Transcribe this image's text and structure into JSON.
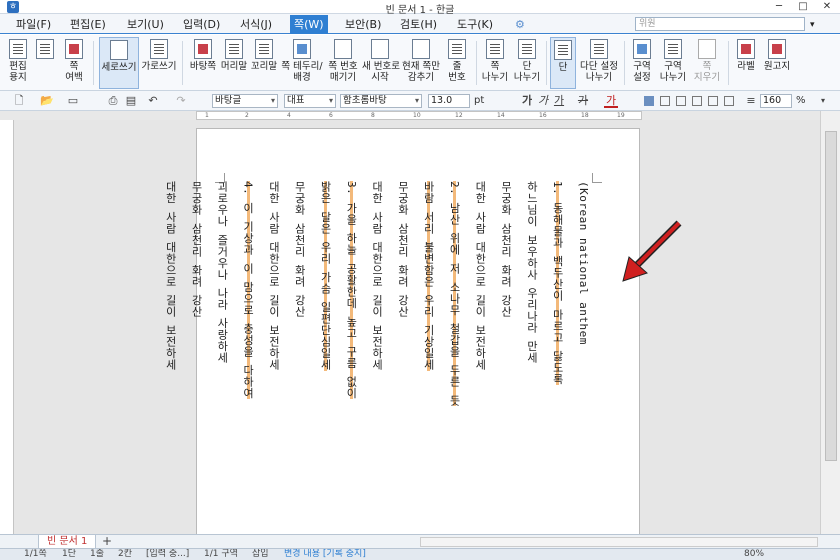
{
  "window": {
    "title": "빈 문서 1 - 한글",
    "minimize": "─",
    "maximize": "□",
    "close": "✕"
  },
  "menu": {
    "items": [
      "파일(F)",
      "편집(E)",
      "보기(U)",
      "입력(D)",
      "서식(J)",
      "쪽(W)",
      "보안(B)",
      "검토(H)",
      "도구(K)"
    ],
    "active": "쪽(W)",
    "search_placeholder": "위원"
  },
  "ribbon": {
    "buttons": [
      {
        "label": "편집\n용지",
        "icon": "page-setup-icon"
      },
      {
        "label": "",
        "icon": "page-portrait-icon"
      },
      {
        "label": "쪽\n여백",
        "icon": "margin-icon"
      },
      {
        "label": "세로쓰기",
        "icon": "vertical-writing-icon",
        "selected": true
      },
      {
        "label": "가로쓰기",
        "icon": "horizontal-writing-icon"
      },
      {
        "label": "바탕쪽",
        "icon": "master-page-icon"
      },
      {
        "label": "머리말",
        "icon": "header-icon"
      },
      {
        "label": "꼬리말",
        "icon": "footer-icon"
      },
      {
        "label": "쪽 테두리/\n배경",
        "icon": "page-border-icon"
      },
      {
        "label": "쪽 번호\n매기기",
        "icon": "page-number-icon"
      },
      {
        "label": "새 번호로\n시작",
        "icon": "new-number-icon"
      },
      {
        "label": "현재 쪽만\n감추기",
        "icon": "hide-icon"
      },
      {
        "label": "줄\n번호",
        "icon": "line-number-icon"
      },
      {
        "label": "쪽\n나누기",
        "icon": "page-break-icon"
      },
      {
        "label": "단\n나누기",
        "icon": "column-break-icon"
      },
      {
        "label": "단",
        "icon": "columns-icon",
        "selected": true
      },
      {
        "label": "다단 설정\n나누기",
        "icon": "multi-column-icon"
      },
      {
        "label": "구역\n설정",
        "icon": "section-setup-icon"
      },
      {
        "label": "구역\n나누기",
        "icon": "section-break-icon"
      },
      {
        "label": "쪽\n지우기",
        "icon": "delete-page-icon",
        "disabled": true
      },
      {
        "label": "라벨",
        "icon": "label-icon"
      },
      {
        "label": "원고지",
        "icon": "manuscript-icon"
      }
    ]
  },
  "toolbar": {
    "style": "바탕글",
    "lang": "대표",
    "font": "함초롬바탕",
    "size": "13.0",
    "size_unit": "pt",
    "bold": "가",
    "italic": "가",
    "underline": "가",
    "strike": "가",
    "color": "가",
    "zoom": "160",
    "zoom_unit": "%"
  },
  "ruler": {
    "ticks": [
      "1",
      "2",
      "4",
      "6",
      "8",
      "10",
      "12",
      "14",
      "16",
      "18",
      "19"
    ]
  },
  "document": {
    "columns": [
      {
        "text": "(Korean national anthem",
        "highlight": false
      },
      {
        "text": "1. 동해물과 백두산이 마르고 닳도록",
        "highlight": true
      },
      {
        "text": "하느님이 보우하사 우리나라 만세",
        "highlight": false
      },
      {
        "text": "무궁화 삼천리 화려 강산",
        "highlight": false
      },
      {
        "text": "대한 사람 대한으로 길이 보전하세",
        "highlight": false
      },
      {
        "text": "2. 남산 위에 저 소나무 철갑을 두른 듯",
        "highlight": true
      },
      {
        "text": "바람 서리 불변함은 우리 기상일세",
        "highlight": true
      },
      {
        "text": "무궁화 삼천리 화려 강산",
        "highlight": false
      },
      {
        "text": "대한 사람 대한으로 길이 보전하세",
        "highlight": false
      },
      {
        "text": "3. 가을 하늘 공활한데 높고 구름 없이",
        "highlight": true
      },
      {
        "text": "밝은 달은 우리 가슴 일편단심일세",
        "highlight": true
      },
      {
        "text": "무궁화 삼천리 화려 강산",
        "highlight": false
      },
      {
        "text": "대한 사람 대한으로 길이 보전하세",
        "highlight": false
      },
      {
        "text": "4. 이 기상과 이 맘으로 충성을 다하여",
        "highlight": true
      },
      {
        "text": "괴로우나 즐거우나 나라 사랑하세",
        "highlight": false
      },
      {
        "text": "무궁화 삼천리 화려 강산",
        "highlight": false
      },
      {
        "text": "대한 사람 대한으로 길이 보전하세",
        "highlight": false
      }
    ]
  },
  "tabs": {
    "doc_tab": "빈 문서 1",
    "add": "+"
  },
  "status": {
    "page": "1/1쪽",
    "column": "1단",
    "line": "1줄",
    "char": "2칸",
    "mode": "[입력 중...]",
    "section": "1/1 구역",
    "insert": "삽입",
    "track": "변경 내용 [기록 중지]",
    "zoom": "80%"
  },
  "colors": {
    "accent": "#2f7fd2",
    "arrow": "#d02020",
    "highlight": "#f3b97a"
  }
}
